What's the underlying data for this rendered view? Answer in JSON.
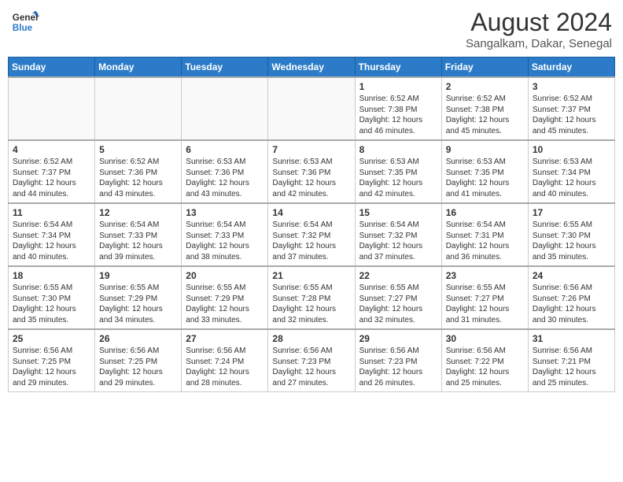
{
  "header": {
    "logo_line1": "General",
    "logo_line2": "Blue",
    "month_year": "August 2024",
    "location": "Sangalkam, Dakar, Senegal"
  },
  "days_of_week": [
    "Sunday",
    "Monday",
    "Tuesday",
    "Wednesday",
    "Thursday",
    "Friday",
    "Saturday"
  ],
  "weeks": [
    [
      {
        "day": "",
        "info": ""
      },
      {
        "day": "",
        "info": ""
      },
      {
        "day": "",
        "info": ""
      },
      {
        "day": "",
        "info": ""
      },
      {
        "day": "1",
        "info": "Sunrise: 6:52 AM\nSunset: 7:38 PM\nDaylight: 12 hours\nand 46 minutes."
      },
      {
        "day": "2",
        "info": "Sunrise: 6:52 AM\nSunset: 7:38 PM\nDaylight: 12 hours\nand 45 minutes."
      },
      {
        "day": "3",
        "info": "Sunrise: 6:52 AM\nSunset: 7:37 PM\nDaylight: 12 hours\nand 45 minutes."
      }
    ],
    [
      {
        "day": "4",
        "info": "Sunrise: 6:52 AM\nSunset: 7:37 PM\nDaylight: 12 hours\nand 44 minutes."
      },
      {
        "day": "5",
        "info": "Sunrise: 6:52 AM\nSunset: 7:36 PM\nDaylight: 12 hours\nand 43 minutes."
      },
      {
        "day": "6",
        "info": "Sunrise: 6:53 AM\nSunset: 7:36 PM\nDaylight: 12 hours\nand 43 minutes."
      },
      {
        "day": "7",
        "info": "Sunrise: 6:53 AM\nSunset: 7:36 PM\nDaylight: 12 hours\nand 42 minutes."
      },
      {
        "day": "8",
        "info": "Sunrise: 6:53 AM\nSunset: 7:35 PM\nDaylight: 12 hours\nand 42 minutes."
      },
      {
        "day": "9",
        "info": "Sunrise: 6:53 AM\nSunset: 7:35 PM\nDaylight: 12 hours\nand 41 minutes."
      },
      {
        "day": "10",
        "info": "Sunrise: 6:53 AM\nSunset: 7:34 PM\nDaylight: 12 hours\nand 40 minutes."
      }
    ],
    [
      {
        "day": "11",
        "info": "Sunrise: 6:54 AM\nSunset: 7:34 PM\nDaylight: 12 hours\nand 40 minutes."
      },
      {
        "day": "12",
        "info": "Sunrise: 6:54 AM\nSunset: 7:33 PM\nDaylight: 12 hours\nand 39 minutes."
      },
      {
        "day": "13",
        "info": "Sunrise: 6:54 AM\nSunset: 7:33 PM\nDaylight: 12 hours\nand 38 minutes."
      },
      {
        "day": "14",
        "info": "Sunrise: 6:54 AM\nSunset: 7:32 PM\nDaylight: 12 hours\nand 37 minutes."
      },
      {
        "day": "15",
        "info": "Sunrise: 6:54 AM\nSunset: 7:32 PM\nDaylight: 12 hours\nand 37 minutes."
      },
      {
        "day": "16",
        "info": "Sunrise: 6:54 AM\nSunset: 7:31 PM\nDaylight: 12 hours\nand 36 minutes."
      },
      {
        "day": "17",
        "info": "Sunrise: 6:55 AM\nSunset: 7:30 PM\nDaylight: 12 hours\nand 35 minutes."
      }
    ],
    [
      {
        "day": "18",
        "info": "Sunrise: 6:55 AM\nSunset: 7:30 PM\nDaylight: 12 hours\nand 35 minutes."
      },
      {
        "day": "19",
        "info": "Sunrise: 6:55 AM\nSunset: 7:29 PM\nDaylight: 12 hours\nand 34 minutes."
      },
      {
        "day": "20",
        "info": "Sunrise: 6:55 AM\nSunset: 7:29 PM\nDaylight: 12 hours\nand 33 minutes."
      },
      {
        "day": "21",
        "info": "Sunrise: 6:55 AM\nSunset: 7:28 PM\nDaylight: 12 hours\nand 32 minutes."
      },
      {
        "day": "22",
        "info": "Sunrise: 6:55 AM\nSunset: 7:27 PM\nDaylight: 12 hours\nand 32 minutes."
      },
      {
        "day": "23",
        "info": "Sunrise: 6:55 AM\nSunset: 7:27 PM\nDaylight: 12 hours\nand 31 minutes."
      },
      {
        "day": "24",
        "info": "Sunrise: 6:56 AM\nSunset: 7:26 PM\nDaylight: 12 hours\nand 30 minutes."
      }
    ],
    [
      {
        "day": "25",
        "info": "Sunrise: 6:56 AM\nSunset: 7:25 PM\nDaylight: 12 hours\nand 29 minutes."
      },
      {
        "day": "26",
        "info": "Sunrise: 6:56 AM\nSunset: 7:25 PM\nDaylight: 12 hours\nand 29 minutes."
      },
      {
        "day": "27",
        "info": "Sunrise: 6:56 AM\nSunset: 7:24 PM\nDaylight: 12 hours\nand 28 minutes."
      },
      {
        "day": "28",
        "info": "Sunrise: 6:56 AM\nSunset: 7:23 PM\nDaylight: 12 hours\nand 27 minutes."
      },
      {
        "day": "29",
        "info": "Sunrise: 6:56 AM\nSunset: 7:23 PM\nDaylight: 12 hours\nand 26 minutes."
      },
      {
        "day": "30",
        "info": "Sunrise: 6:56 AM\nSunset: 7:22 PM\nDaylight: 12 hours\nand 25 minutes."
      },
      {
        "day": "31",
        "info": "Sunrise: 6:56 AM\nSunset: 7:21 PM\nDaylight: 12 hours\nand 25 minutes."
      }
    ]
  ]
}
